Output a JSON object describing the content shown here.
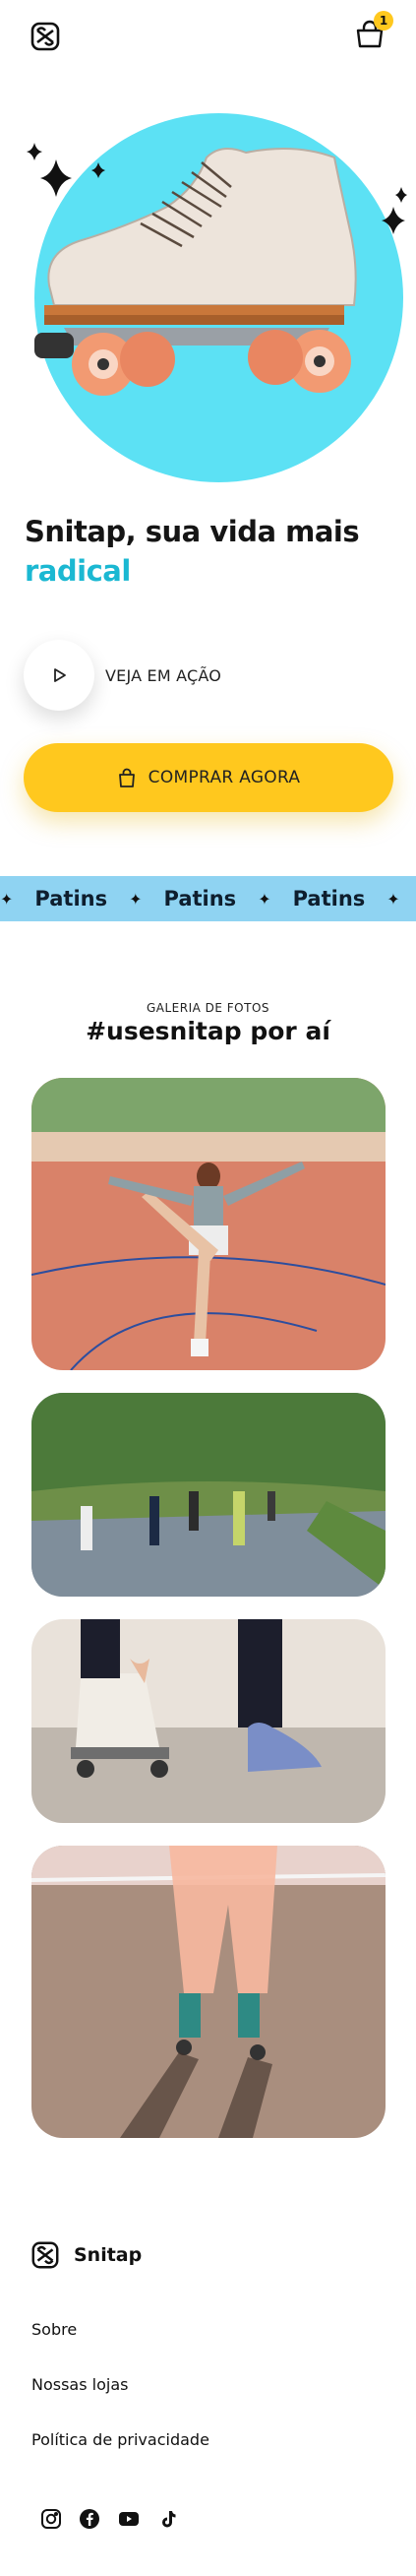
{
  "header": {
    "logo_icon": "snitap-logo-icon",
    "cart_icon": "shopping-bag-icon",
    "cart_count": "1"
  },
  "hero": {
    "headline_main": "Snitap, sua vida mais",
    "headline_accent": "radical",
    "play_label": "VEJA EM AÇÃO",
    "buy_label": "COMPRAR AGORA",
    "circle_color": "#5CE1F4",
    "accent_color": "#1BB8D2",
    "button_color": "#FFC81E"
  },
  "marquee": {
    "items": [
      "Patins",
      "Patins",
      "Patins"
    ],
    "bg_color": "#8FD3F2"
  },
  "gallery": {
    "eyebrow": "GALERIA DE FOTOS",
    "title": "#usesnitap por aí"
  },
  "footer": {
    "brand": "Snitap",
    "links": [
      "Sobre",
      "Nossas lojas",
      "Política de privacidade"
    ],
    "social": [
      "instagram-icon",
      "facebook-icon",
      "youtube-icon",
      "tiktok-icon"
    ]
  }
}
